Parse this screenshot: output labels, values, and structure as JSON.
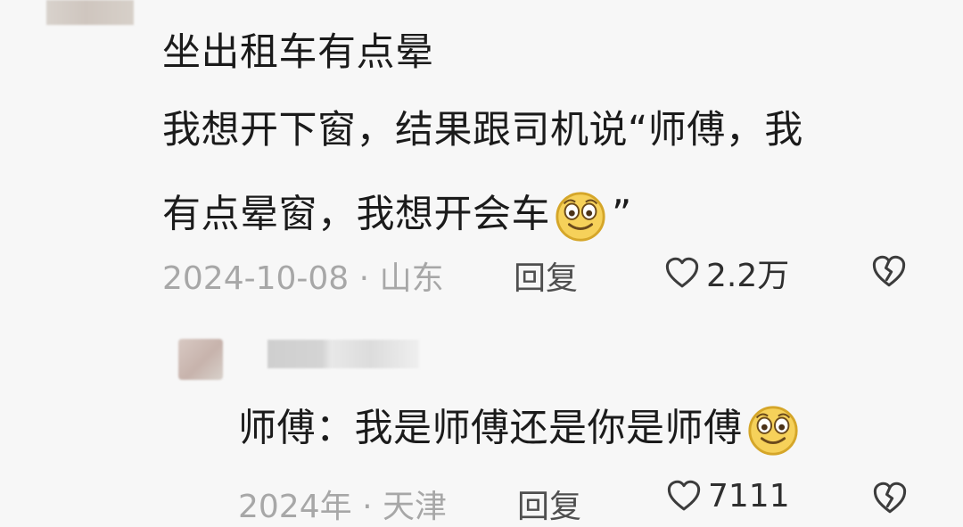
{
  "comment": {
    "line1": "坐出租车有点晕",
    "line2": "我想开下窗，结果跟司机说“师傅，我",
    "line3_before_emoji": "有点晕窗，我想开会车",
    "line3_after_emoji": "”",
    "date": "2024-10-08",
    "dot": "·",
    "location": "山东",
    "reply_label": "回复",
    "likes": "2.2万"
  },
  "reply": {
    "text_before_emoji": "师傅：我是师傅还是你是师傅",
    "date": "2024年",
    "dot": "·",
    "location": "天津",
    "reply_label": "回复",
    "likes": "7111"
  },
  "icons": {
    "emoji": "smile-emoji-icon",
    "like": "heart-outline-icon",
    "dislike": "broken-heart-icon"
  },
  "colors": {
    "text": "#1b1b1b",
    "meta": "#a7a7a7",
    "action": "#4f4f4f"
  }
}
